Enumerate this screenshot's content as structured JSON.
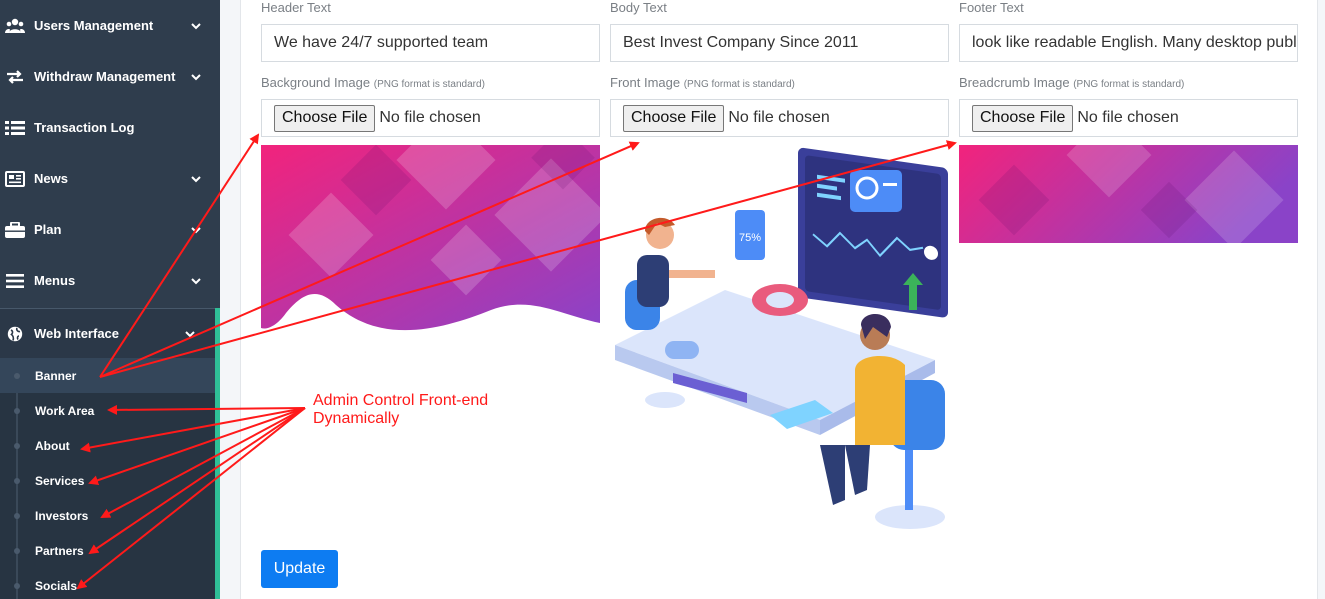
{
  "sidebar": {
    "items": [
      {
        "label": "Users Management",
        "icon": "users-icon",
        "chevron": true
      },
      {
        "label": "Withdraw Management",
        "icon": "exchange-icon",
        "chevron": true
      },
      {
        "label": "Transaction Log",
        "icon": "list-icon",
        "chevron": false
      },
      {
        "label": "News",
        "icon": "newspaper-icon",
        "chevron": true
      },
      {
        "label": "Plan",
        "icon": "briefcase-icon",
        "chevron": true
      },
      {
        "label": "Menus",
        "icon": "menu-bars-icon",
        "chevron": true
      },
      {
        "label": "Web Interface",
        "icon": "globe-icon",
        "chevron": true,
        "expanded": true
      }
    ],
    "subitems": [
      {
        "label": "Banner",
        "active": true
      },
      {
        "label": "Work Area"
      },
      {
        "label": "About"
      },
      {
        "label": "Services"
      },
      {
        "label": "Investors"
      },
      {
        "label": "Partners"
      },
      {
        "label": "Socials"
      }
    ]
  },
  "form": {
    "header_text": {
      "label": "Header Text",
      "value": "We have 24/7 supported team"
    },
    "body_text": {
      "label": "Body Text",
      "value": "Best Invest Company Since 2011"
    },
    "footer_text": {
      "label": "Footer Text",
      "value": "look like readable English. Many desktop publ"
    },
    "background_image": {
      "label": "Background Image",
      "hint": "(PNG format is standard)",
      "button": "Choose File",
      "status": "No file chosen"
    },
    "front_image": {
      "label": "Front Image",
      "hint": "(PNG format is standard)",
      "button": "Choose File",
      "status": "No file chosen"
    },
    "breadcrumb_image": {
      "label": "Breadcrumb Image",
      "hint": "(PNG format is standard)",
      "button": "Choose File",
      "status": "No file chosen"
    },
    "update_label": "Update",
    "illustration_badge": "75%"
  },
  "annotation": {
    "line1": "Admin Control Front-end",
    "line2": "Dynamically"
  },
  "colors": {
    "sidebar_bg": "#2f3d4d",
    "accent": "#2fbf97",
    "primary": "#0d7cf2",
    "annotation": "#ff1a1a",
    "banner_pink": "#f2237c",
    "banner_purple": "#8a43c8"
  }
}
